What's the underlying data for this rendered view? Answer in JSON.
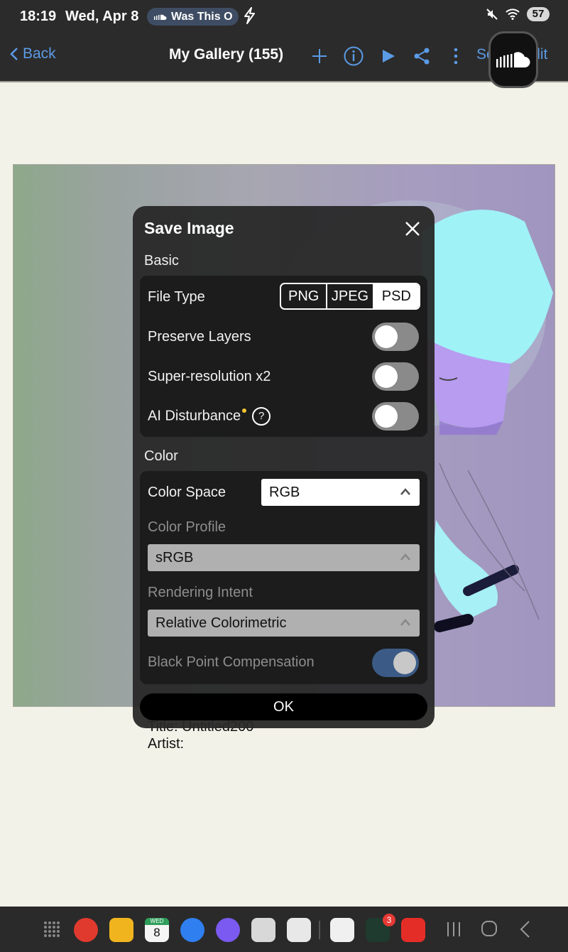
{
  "status": {
    "time": "18:19",
    "date": "Wed, Apr 8",
    "pill_text": "Was This O",
    "battery": "57"
  },
  "nav": {
    "back_label": "Back",
    "title": "My Gallery (155)",
    "edit_label": "Select/Edit"
  },
  "artwork_info": {
    "title": "Title: Untitled200",
    "artist": "Artist:"
  },
  "dialog": {
    "title": "Save Image",
    "basic_label": "Basic",
    "file_type_label": "File Type",
    "file_types": [
      "PNG",
      "JPEG",
      "PSD"
    ],
    "selected_file_type": "PSD",
    "preserve_layers_label": "Preserve Layers",
    "preserve_layers": false,
    "super_res_label": "Super-resolution x2",
    "super_res": false,
    "ai_disturbance_label": "AI Disturbance",
    "ai_disturbance": false,
    "help_glyph": "?",
    "color_label": "Color",
    "color_space_label": "Color Space",
    "color_space_value": "RGB",
    "color_profile_label": "Color Profile",
    "color_profile_value": "sRGB",
    "rendering_intent_label": "Rendering Intent",
    "rendering_intent_value": "Relative Colorimetric",
    "bpc_label": "Black Point Compensation",
    "bpc": true,
    "ok_label": "OK"
  },
  "dock": {
    "calendar_day": "8",
    "calendar_month": "WED",
    "notification_badge": "3"
  },
  "colors": {
    "accent": "#5b9be6",
    "bar": "#2b2b2b",
    "page_bg": "#f3f2e8"
  }
}
